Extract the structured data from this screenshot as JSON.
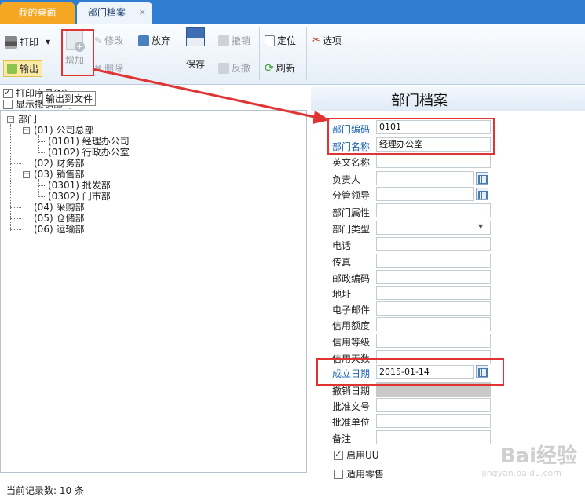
{
  "tabs": [
    {
      "label": "我的桌面"
    },
    {
      "label": "部门档案",
      "close": "×"
    }
  ],
  "toolbar": {
    "print": "打印",
    "export": "输出",
    "add": "增加",
    "modify": "修改",
    "delete": "删除",
    "discard": "放弃",
    "save": "保存",
    "undo": "撤销",
    "reverse": "反撤",
    "locate": "定位",
    "refresh": "刷新",
    "options": "选项"
  },
  "tooltip": "输出到文件",
  "options": {
    "print_serial": "打印序号(N)",
    "show_cancelled": "显示撤销部门"
  },
  "page_title": "部门档案",
  "tree": {
    "root": "部门",
    "items": [
      {
        "label": "(01) 公司总部"
      },
      {
        "label": "(0101) 经理办公司"
      },
      {
        "label": "(0102) 行政办公室"
      },
      {
        "label": "(02) 财务部"
      },
      {
        "label": "(03) 销售部"
      },
      {
        "label": "(0301) 批发部"
      },
      {
        "label": "(0302) 门市部"
      },
      {
        "label": "(04) 采购部"
      },
      {
        "label": "(05) 仓储部"
      },
      {
        "label": "(06) 运输部"
      }
    ]
  },
  "form": {
    "dept_code": {
      "label": "部门编码",
      "value": "0101"
    },
    "dept_name": {
      "label": "部门名称",
      "value": "经理办公室"
    },
    "english_name": {
      "label": "英文名称",
      "value": ""
    },
    "manager": {
      "label": "负责人",
      "value": ""
    },
    "supervisor": {
      "label": "分管领导",
      "value": ""
    },
    "attribute": {
      "label": "部门属性",
      "value": ""
    },
    "dept_type": {
      "label": "部门类型",
      "value": ""
    },
    "phone": {
      "label": "电话",
      "value": ""
    },
    "fax": {
      "label": "传真",
      "value": ""
    },
    "postcode": {
      "label": "邮政编码",
      "value": ""
    },
    "address": {
      "label": "地址",
      "value": ""
    },
    "email": {
      "label": "电子邮件",
      "value": ""
    },
    "credit_limit": {
      "label": "信用额度",
      "value": ""
    },
    "credit_level": {
      "label": "信用等级",
      "value": ""
    },
    "credit_days": {
      "label": "信用天数",
      "value": ""
    },
    "est_date": {
      "label": "成立日期",
      "value": "2015-01-14"
    },
    "cancel_date": {
      "label": "撤销日期",
      "value": ""
    },
    "approval_no": {
      "label": "批准文号",
      "value": ""
    },
    "approval_unit": {
      "label": "批准单位",
      "value": ""
    },
    "remark": {
      "label": "备注",
      "value": ""
    },
    "enable_uu": {
      "label": "启用UU",
      "checked": true
    },
    "retail": {
      "label": "适用零售",
      "checked": false
    }
  },
  "status": "当前记录数: 10 条",
  "watermark": {
    "main": "Bai经验",
    "sub": "jingyan.baidu.com"
  },
  "colors": {
    "tab_bar": "#2f7dd0",
    "active_tab": "#f5a623",
    "highlight_box": "#e03333",
    "link_label": "#1a64b6"
  }
}
